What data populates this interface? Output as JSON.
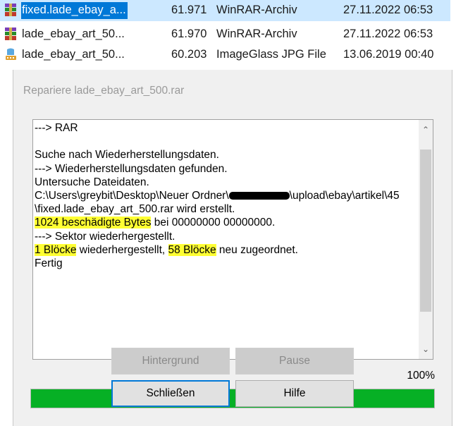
{
  "files": [
    {
      "name": "fixed.lade_ebay_a...",
      "size": "61.971",
      "type": "WinRAR-Archiv",
      "date": "27.11.2022 06:53",
      "icon": "winrar-archive-icon",
      "selected": true
    },
    {
      "name": "lade_ebay_art_50...",
      "size": "61.970",
      "type": "WinRAR-Archiv",
      "date": "27.11.2022 06:53",
      "icon": "winrar-archive-icon",
      "selected": false
    },
    {
      "name": "lade_ebay_art_50...",
      "size": "60.203",
      "type": "ImageGlass JPG File",
      "date": "13.06.2019 00:40",
      "icon": "jpg-file-icon",
      "selected": false
    }
  ],
  "dialog": {
    "title": "Repariere lade_ebay_art_500.rar",
    "log": {
      "line1": "---> RAR",
      "line2": "",
      "line3": "Suche nach Wiederherstellungsdaten.",
      "line4": "---> Wiederherstellungsdaten gefunden.",
      "line5": "Untersuche Dateidaten.",
      "line6a": "C:\\Users\\greybit\\Desktop\\Neuer Ordner\\",
      "line6b": "\\upload\\ebay\\artikel\\45",
      "line7": "\\fixed.lade_ebay_art_500.rar wird erstellt.",
      "line8a": "1024 beschädigte Bytes",
      "line8b": " bei 00000000 00000000.",
      "line9": "---> Sektor wiederhergestellt.",
      "line10a": "1 Blöcke",
      "line10b": " wiederhergestellt, ",
      "line10c": "58 Blöcke",
      "line10d": " neu zugeordnet.",
      "line11": "Fertig"
    },
    "progress_label": "100%",
    "progress_value": 1.0,
    "buttons": {
      "background": "Hintergrund",
      "pause": "Pause",
      "close": "Schließen",
      "help": "Hilfe"
    }
  },
  "colors": {
    "progress_fill": "#06b025",
    "highlight": "#ffff33",
    "selection": "#0078d7"
  }
}
